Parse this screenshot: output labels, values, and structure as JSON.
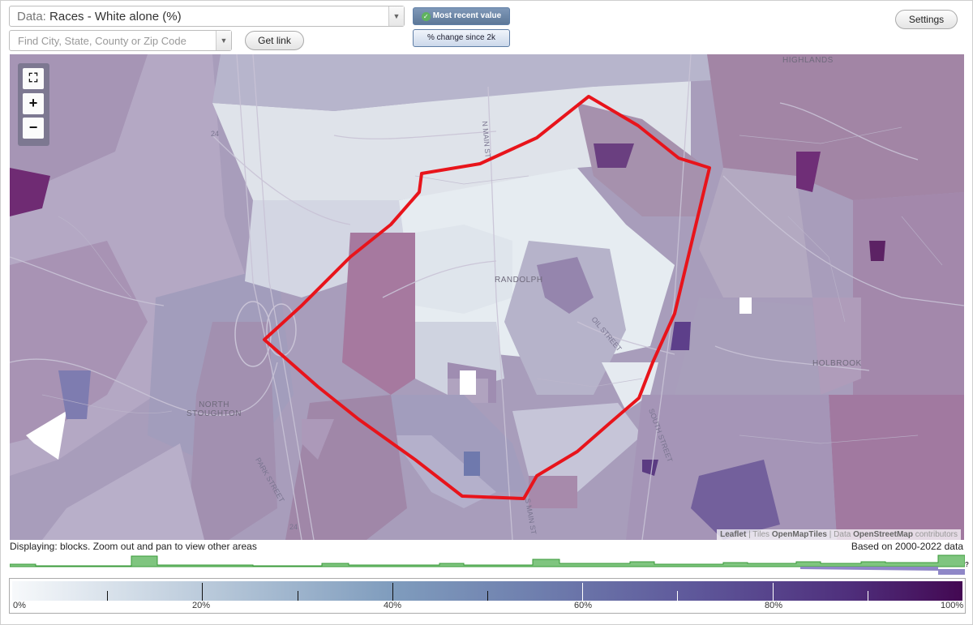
{
  "data_select": {
    "prefix": "Data:",
    "value": "Races - White alone (%)"
  },
  "search": {
    "placeholder": "Find City, State, County or Zip Code"
  },
  "buttons": {
    "get_link": "Get link",
    "settings": "Settings"
  },
  "toggles": {
    "most_recent": "Most recent value",
    "pct_change": "% change since 2k"
  },
  "zoom": {
    "fit": "⛶",
    "in": "+",
    "out": "−"
  },
  "map": {
    "place_labels": [
      "HIGHLANDS",
      "RANDOLPH",
      "HOLBROOK",
      "NORTH STOUGHTON"
    ],
    "road_labels": [
      "24",
      "24"
    ],
    "street_labels": [
      "N MAIN ST",
      "OIL STREET",
      "PARK STREET",
      "S MAIN ST",
      "SOUTH STREET"
    ],
    "attribution": {
      "leaflet": "Leaflet",
      "tiles_prefix": "| Tiles",
      "tiles": "OpenMapTiles",
      "data_prefix": "| Data",
      "data": "OpenStreetMap",
      "suffix": "contributors"
    },
    "outline_color": "#e8141b"
  },
  "footer": {
    "displaying": "Displaying: blocks. Zoom out and pan to view other areas",
    "based_on": "Based on 2000-2022 data",
    "histogram_color": "#7fc57f",
    "histogram_question": "?"
  },
  "legend": {
    "labels": [
      "0%",
      "20%",
      "40%",
      "60%",
      "80%",
      "100%"
    ],
    "ramp_colors": [
      "#f7f9fb",
      "#b5c6d8",
      "#7f9cbd",
      "#6f7fae",
      "#5e579a",
      "#4f2f7c",
      "#430852"
    ]
  }
}
